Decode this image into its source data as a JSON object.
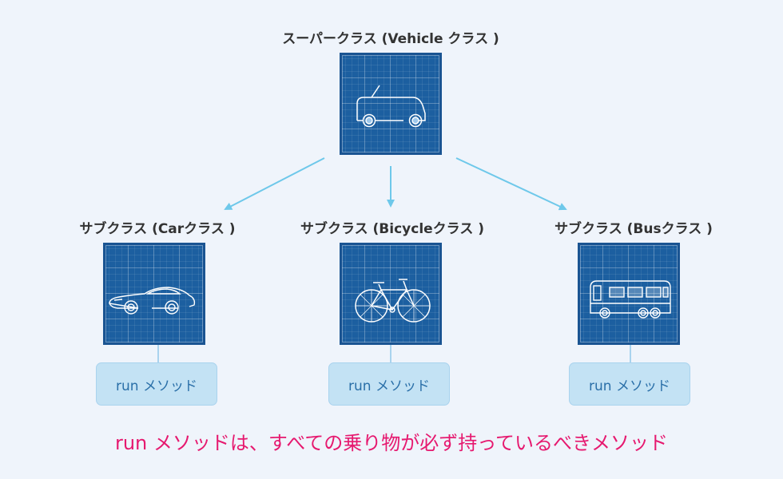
{
  "superclass": {
    "label": "スーパークラス (Vehicle クラス )",
    "icon": "van-icon"
  },
  "subclasses": [
    {
      "label": "サブクラス (Carクラス )",
      "icon": "sports-car-icon",
      "method": "run メソッド"
    },
    {
      "label": "サブクラス (Bicycleクラス )",
      "icon": "bicycle-icon",
      "method": "run メソッド"
    },
    {
      "label": "サブクラス (Busクラス )",
      "icon": "bus-icon",
      "method": "run メソッド"
    }
  ],
  "note": "run メソッドは、すべての乗り物が必ず持っているべきメソッド",
  "colors": {
    "blueprint": "#1c5fa0",
    "arrow": "#6ec8ea",
    "method_box": "#c3e2f4",
    "method_text": "#2a6fa8",
    "note": "#e6196f",
    "background": "#eff4fb"
  }
}
